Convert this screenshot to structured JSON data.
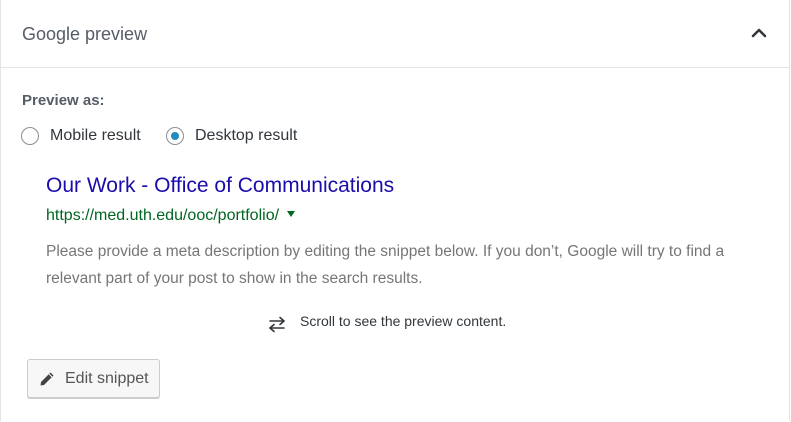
{
  "panel": {
    "title": "Google preview",
    "collapse_icon": "chevron-up-icon"
  },
  "preview_as": {
    "label": "Preview as:",
    "options": [
      {
        "label": "Mobile result",
        "selected": false
      },
      {
        "label": "Desktop result",
        "selected": true
      }
    ],
    "accent_color": "#1e8cbe"
  },
  "serp": {
    "title": "Our Work - Office of Communications",
    "url": "https://med.uth.edu/ooc/portfolio/",
    "url_icon": "caret-down-icon",
    "description": "Please provide a meta description by editing the snippet below. If you don’t, Google will try to find a relevant part of your post to show in the search results.",
    "title_color": "#1a0dab",
    "url_color": "#006621"
  },
  "scroll_hint": {
    "icon": "swap-arrows-icon",
    "text": "Scroll to see the preview content."
  },
  "edit_snippet": {
    "icon": "pencil-icon",
    "label": "Edit snippet"
  }
}
